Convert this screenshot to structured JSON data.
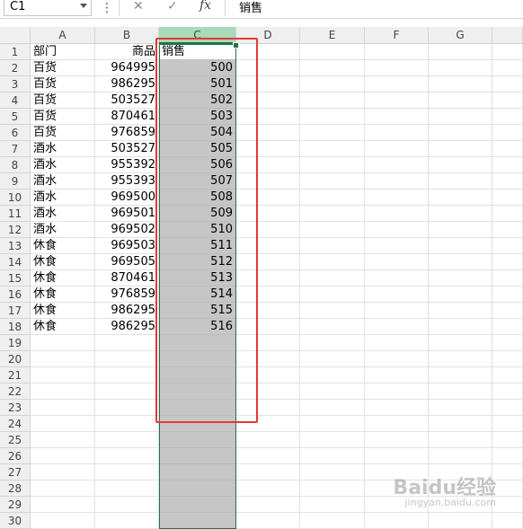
{
  "formula_bar": {
    "name_box": "C1",
    "more_icon": "⋮",
    "cancel_icon": "✕",
    "enter_icon": "✓",
    "fx_label": "fx",
    "formula": "销售"
  },
  "columns": [
    "A",
    "B",
    "C",
    "D",
    "E",
    "F",
    "G"
  ],
  "selected_column": "C",
  "rows": [
    {
      "n": "1",
      "a": "部门",
      "b": "商品",
      "c": "销售"
    },
    {
      "n": "2",
      "a": "百货",
      "b": "964995",
      "c": "500"
    },
    {
      "n": "3",
      "a": "百货",
      "b": "986295",
      "c": "501"
    },
    {
      "n": "4",
      "a": "百货",
      "b": "503527",
      "c": "502"
    },
    {
      "n": "5",
      "a": "百货",
      "b": "870461",
      "c": "503"
    },
    {
      "n": "6",
      "a": "百货",
      "b": "976859",
      "c": "504"
    },
    {
      "n": "7",
      "a": "酒水",
      "b": "503527",
      "c": "505"
    },
    {
      "n": "8",
      "a": "酒水",
      "b": "955392",
      "c": "506"
    },
    {
      "n": "9",
      "a": "酒水",
      "b": "955393",
      "c": "507"
    },
    {
      "n": "10",
      "a": "酒水",
      "b": "969500",
      "c": "508"
    },
    {
      "n": "11",
      "a": "酒水",
      "b": "969501",
      "c": "509"
    },
    {
      "n": "12",
      "a": "酒水",
      "b": "969502",
      "c": "510"
    },
    {
      "n": "13",
      "a": "休食",
      "b": "969503",
      "c": "511"
    },
    {
      "n": "14",
      "a": "休食",
      "b": "969505",
      "c": "512"
    },
    {
      "n": "15",
      "a": "休食",
      "b": "870461",
      "c": "513"
    },
    {
      "n": "16",
      "a": "休食",
      "b": "976859",
      "c": "514"
    },
    {
      "n": "17",
      "a": "休食",
      "b": "986295",
      "c": "515"
    },
    {
      "n": "18",
      "a": "休食",
      "b": "986295",
      "c": "516"
    },
    {
      "n": "19",
      "a": "",
      "b": "",
      "c": ""
    },
    {
      "n": "20",
      "a": "",
      "b": "",
      "c": ""
    },
    {
      "n": "21",
      "a": "",
      "b": "",
      "c": ""
    },
    {
      "n": "22",
      "a": "",
      "b": "",
      "c": ""
    },
    {
      "n": "23",
      "a": "",
      "b": "",
      "c": ""
    },
    {
      "n": "24",
      "a": "",
      "b": "",
      "c": ""
    },
    {
      "n": "25",
      "a": "",
      "b": "",
      "c": ""
    },
    {
      "n": "26",
      "a": "",
      "b": "",
      "c": ""
    },
    {
      "n": "27",
      "a": "",
      "b": "",
      "c": ""
    },
    {
      "n": "28",
      "a": "",
      "b": "",
      "c": ""
    },
    {
      "n": "29",
      "a": "",
      "b": "",
      "c": ""
    },
    {
      "n": "30",
      "a": "",
      "b": "",
      "c": ""
    }
  ],
  "watermark": {
    "text": "Baidu经验",
    "sub": "jingyan.baidu.com"
  },
  "colors": {
    "accent": "#217346",
    "selection": "#c6c6c6",
    "highlight_box": "#e53935"
  }
}
